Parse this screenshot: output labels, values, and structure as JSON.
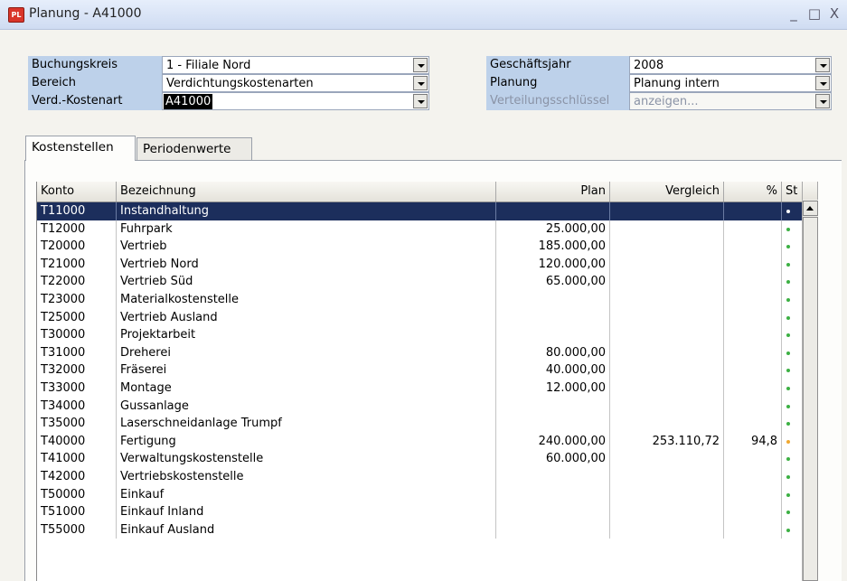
{
  "window": {
    "icon_text": "PL",
    "title": "Planung - A41000",
    "min_glyph": "_",
    "max_glyph": "□",
    "close_glyph": "X"
  },
  "fields": {
    "buchungskreis": {
      "label": "Buchungskreis",
      "value": "1 - Filiale Nord"
    },
    "bereich": {
      "label": "Bereich",
      "value": "Verdichtungskostenarten"
    },
    "verd_kostenart": {
      "label": "Verd.-Kostenart",
      "value": "A41000"
    },
    "geschaeftsjahr": {
      "label": "Geschäftsjahr",
      "value": "2008"
    },
    "planung": {
      "label": "Planung",
      "value": "Planung intern"
    },
    "verteilungsschluessel": {
      "label": "Verteilungsschlüssel",
      "value": "anzeigen..."
    }
  },
  "tabs": [
    {
      "label": "Kostenstellen",
      "active": true
    },
    {
      "label": "Periodenwerte",
      "active": false
    }
  ],
  "table": {
    "columns": [
      "Konto",
      "Bezeichnung",
      "Plan",
      "Vergleich",
      "%",
      "St"
    ],
    "rows": [
      {
        "konto": "T11000",
        "bezeichnung": "Instandhaltung",
        "plan": "",
        "vergleich": "",
        "pct": "",
        "status": "white",
        "selected": true
      },
      {
        "konto": "T12000",
        "bezeichnung": "Fuhrpark",
        "plan": "25.000,00",
        "vergleich": "",
        "pct": "",
        "status": "green"
      },
      {
        "konto": "T20000",
        "bezeichnung": "Vertrieb",
        "plan": "185.000,00",
        "vergleich": "",
        "pct": "",
        "status": "green"
      },
      {
        "konto": "T21000",
        "bezeichnung": "Vertrieb Nord",
        "plan": "120.000,00",
        "vergleich": "",
        "pct": "",
        "status": "green"
      },
      {
        "konto": "T22000",
        "bezeichnung": "Vertrieb Süd",
        "plan": "65.000,00",
        "vergleich": "",
        "pct": "",
        "status": "green"
      },
      {
        "konto": "T23000",
        "bezeichnung": "Materialkostenstelle",
        "plan": "",
        "vergleich": "",
        "pct": "",
        "status": "green"
      },
      {
        "konto": "T25000",
        "bezeichnung": "Vertrieb Ausland",
        "plan": "",
        "vergleich": "",
        "pct": "",
        "status": "green"
      },
      {
        "konto": "T30000",
        "bezeichnung": "Projektarbeit",
        "plan": "",
        "vergleich": "",
        "pct": "",
        "status": "green"
      },
      {
        "konto": "T31000",
        "bezeichnung": "Dreherei",
        "plan": "80.000,00",
        "vergleich": "",
        "pct": "",
        "status": "green"
      },
      {
        "konto": "T32000",
        "bezeichnung": "Fräserei",
        "plan": "40.000,00",
        "vergleich": "",
        "pct": "",
        "status": "green"
      },
      {
        "konto": "T33000",
        "bezeichnung": "Montage",
        "plan": "12.000,00",
        "vergleich": "",
        "pct": "",
        "status": "green"
      },
      {
        "konto": "T34000",
        "bezeichnung": "Gussanlage",
        "plan": "",
        "vergleich": "",
        "pct": "",
        "status": "green"
      },
      {
        "konto": "T35000",
        "bezeichnung": "Laserschneidanlage Trumpf",
        "plan": "",
        "vergleich": "",
        "pct": "",
        "status": "green"
      },
      {
        "konto": "T40000",
        "bezeichnung": "Fertigung",
        "plan": "240.000,00",
        "vergleich": "253.110,72",
        "pct": "94,8",
        "status": "orange"
      },
      {
        "konto": "T41000",
        "bezeichnung": "Verwaltungskostenstelle",
        "plan": "60.000,00",
        "vergleich": "",
        "pct": "",
        "status": "green"
      },
      {
        "konto": "T42000",
        "bezeichnung": "Vertriebskostenstelle",
        "plan": "",
        "vergleich": "",
        "pct": "",
        "status": "green"
      },
      {
        "konto": "T50000",
        "bezeichnung": "Einkauf",
        "plan": "",
        "vergleich": "",
        "pct": "",
        "status": "green"
      },
      {
        "konto": "T51000",
        "bezeichnung": "Einkauf Inland",
        "plan": "",
        "vergleich": "",
        "pct": "",
        "status": "green"
      },
      {
        "konto": "T55000",
        "bezeichnung": "Einkauf Ausland",
        "plan": "",
        "vergleich": "",
        "pct": "",
        "status": "green"
      }
    ]
  },
  "colors": {
    "selected_row": "#1c2e5c",
    "label_bg": "#bdd1ea",
    "status_green": "#3cb043",
    "status_orange": "#f0a830",
    "status_white": "#ffffff"
  }
}
